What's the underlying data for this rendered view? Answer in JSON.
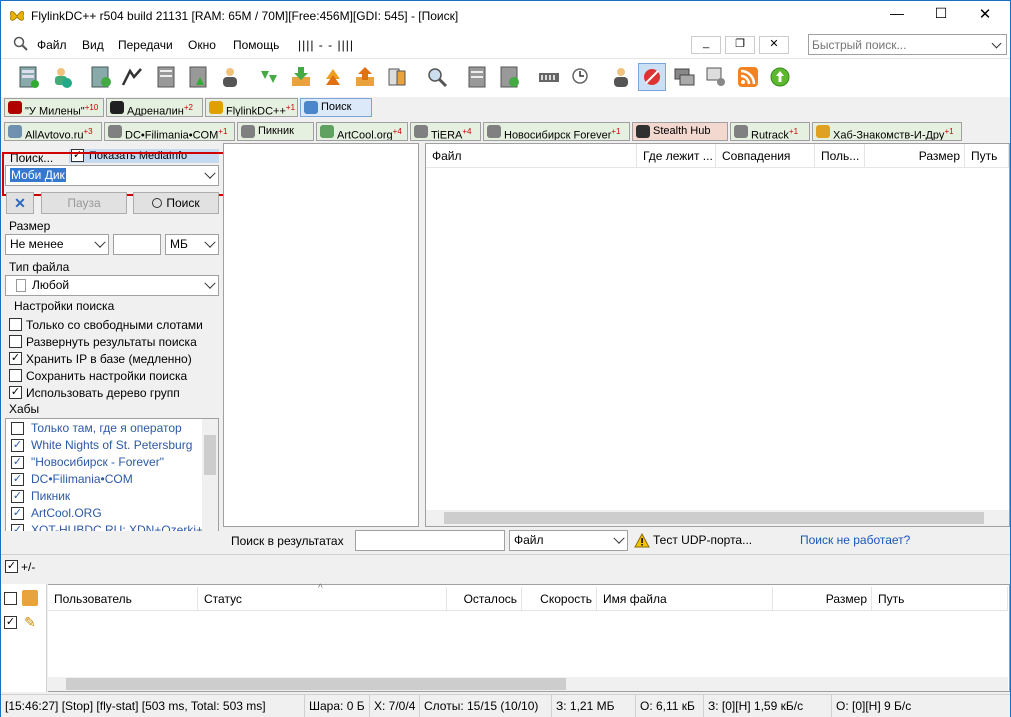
{
  "title": "FlylinkDC++ r504 build 21131 [RAM: 65M / 70M][Free:456M][GDI: 545] - [Поиск]",
  "window_controls": {
    "minimize": "—",
    "maximize": "☐",
    "close": "✕"
  },
  "menu": [
    "Файл",
    "Вид",
    "Передачи",
    "Окно",
    "Помощь"
  ],
  "menu_extra": "|||| - - ||||",
  "mdi_controls": {
    "minimize": "_",
    "restore": "❐",
    "close": "✕"
  },
  "quick_search": {
    "placeholder": "Быстрый поиск..."
  },
  "hub_tabs_row1": [
    {
      "label": "\"У Милены\"",
      "badge": "+10",
      "color": "#b00000"
    },
    {
      "label": "Адреналин",
      "badge": "+2",
      "color": "#202020"
    },
    {
      "label": "FlylinkDC++",
      "badge": "+1",
      "color": "#e0a000"
    },
    {
      "label": "Поиск",
      "badge": "",
      "color": "#4a86c8"
    }
  ],
  "hub_tabs_row2": [
    {
      "label": "AllAvtovo.ru",
      "badge": "+3",
      "color": "#7090b0"
    },
    {
      "label": "DC•Filimania•COM",
      "badge": "+1",
      "color": "#808080"
    },
    {
      "label": "Пикник",
      "badge": "",
      "color": "#808080"
    },
    {
      "label": "ArtCool.org",
      "badge": "+4",
      "color": "#60a060"
    },
    {
      "label": "TiERA",
      "badge": "+4",
      "color": "#808080"
    },
    {
      "label": "Новосибирск Forever",
      "badge": "+1",
      "color": "#808080"
    },
    {
      "label": "Stealth Hub",
      "badge": "",
      "color": "#303030"
    },
    {
      "label": "Rutrack",
      "badge": "+1",
      "color": "#808080"
    },
    {
      "label": "Хаб-Знакомств-И-Дру",
      "badge": "+1",
      "color": "#e0a020"
    }
  ],
  "search_panel": {
    "search_label": "Поиск...",
    "show_mediainfo": "Показать MediaInfo",
    "query": "Моби Дик",
    "pause_label": "Пауза",
    "search_btn": "Поиск",
    "size_label": "Размер",
    "size_mode": "Не менее",
    "size_value": "",
    "size_unit": "МБ",
    "filetype_label": "Тип файла",
    "filetype": "Любой",
    "settings_label": "Настройки поиска",
    "options": [
      {
        "label": "Только со свободными слотами",
        "checked": false
      },
      {
        "label": "Развернуть результаты поиска",
        "checked": false
      },
      {
        "label": "Хранить IP в базе (медленно)",
        "checked": true
      },
      {
        "label": "Сохранить настройки поиска",
        "checked": false
      },
      {
        "label": "Использовать дерево групп",
        "checked": true
      }
    ],
    "hubs_label": "Хабы",
    "hubs": [
      {
        "label": "Только там, где я оператор",
        "checked": false
      },
      {
        "label": "White Nights of St. Petersburg",
        "checked": true
      },
      {
        "label": "\"Новосибирск - Forever\"",
        "checked": true
      },
      {
        "label": "DC•Filimania•COM",
        "checked": true
      },
      {
        "label": "Пикник",
        "checked": true
      },
      {
        "label": "ArtCool.ORG",
        "checked": true
      },
      {
        "label": "XOT-HUBDC.RU: XDN+Ozerki+TiE",
        "checked": true
      }
    ]
  },
  "results_columns": [
    "Файл",
    "Где лежит ...",
    "Совпадения",
    "Поль...",
    "Размер",
    "Путь"
  ],
  "filter_bar": {
    "label": "Поиск в результатах",
    "value": "",
    "column": "Файл",
    "udp_test": "Тест UDP-порта...",
    "not_working_link": "Поиск не работает?"
  },
  "toggle_label": "+/-",
  "transfer_columns": [
    "Пользователь",
    "Статус",
    "Осталось",
    "Скорость",
    "Имя файла",
    "Размер",
    "Путь"
  ],
  "status": [
    "[15:46:27] [Stop] [fly-stat] [503 ms, Total: 503 ms]",
    "Шара: 0 Б",
    "X: 7/0/4",
    "Слоты: 15/15 (10/10)",
    "З: 1,21 МБ",
    "О: 6,11 кБ",
    "З: [0][H] 1,59 кБ/с",
    "О: [0][H] 9 Б/с"
  ],
  "colors": {
    "accent": "#1a6fc4",
    "highlight_box": "#d00000",
    "link": "#1a56b8",
    "hub_text": "#2d59a6"
  }
}
